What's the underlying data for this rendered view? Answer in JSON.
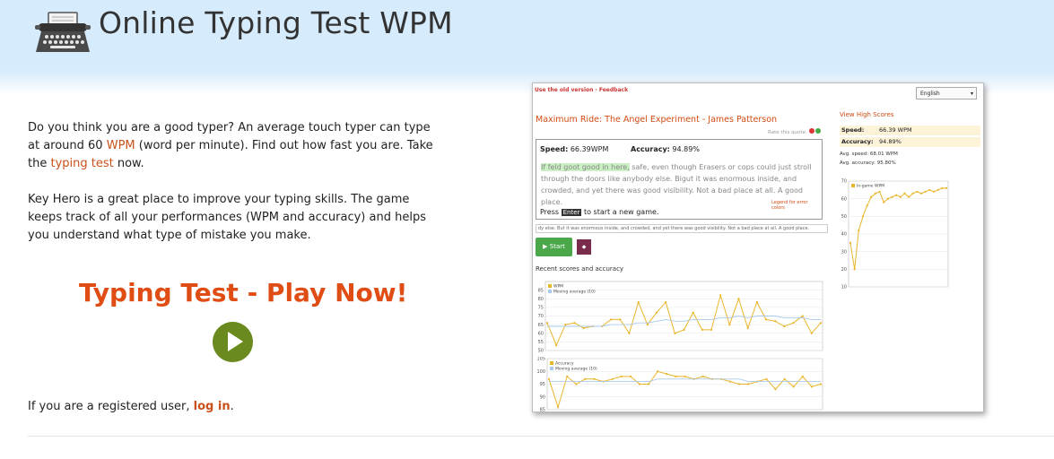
{
  "header": {
    "title": "Online Typing Test WPM",
    "logo_icon": "typewriter-icon",
    "bg": "#d6ebfb"
  },
  "intro": {
    "p1_a": "Do you think you are a good typer? An average touch typer can type at around 60 ",
    "p1_wpm": "WPM",
    "p1_b": " (word per minute). Find out how fast you are. Take the ",
    "p1_link": "typing test",
    "p1_c": " now.",
    "p2": "Key Hero is a great place to improve your typing skills. The game keeps track of all your performances (WPM and accuracy) and helps you understand what type of mistake you make."
  },
  "cta": {
    "label": "Typing Test - Play Now!",
    "play_icon": "play-icon",
    "accent": "#e04d14"
  },
  "login": {
    "text": "If you are a registered user, ",
    "link": "log in",
    "end": "."
  },
  "screenshot": {
    "old_version": "Use the old version · Feedback",
    "language": "English",
    "book_title": "Maximum Ride: The Angel Experiment - James Patterson",
    "rate_quote": "Rate this quote:",
    "speed_label": "Speed:",
    "speed_value": "66.39WPM",
    "accuracy_label": "Accuracy:",
    "accuracy_value": "94.89%",
    "passage_green": "If feld goot good in here,",
    "passage_rest": " safe, even though Erasers or cops could just stroll through the doors like anybody else. Bigut it was enormous inside, and crowded, and yet there was good visibility. Not a bad place at all. A good place.",
    "legend_link": "Legend for error colors",
    "press": "Press",
    "enter_key": "Enter",
    "press_rest": "to start a new game.",
    "strip_text": "dy else. But it was enormous inside, and crowded, and yet there was good visibility. Not a bad place at all. A good place.",
    "start_label": "Start",
    "recent_label": "Recent scores and accuracy",
    "view_high_scores": "View High Scores",
    "hs_speed_label": "Speed:",
    "hs_speed_value": "66.39 WPM",
    "hs_accuracy_label": "Accuracy:",
    "hs_accuracy_value": "94.89%",
    "avg_speed": "Avg. speed: 68.01 WPM",
    "avg_accuracy": "Avg. accuracy: 95.80%"
  },
  "chart_data": [
    {
      "type": "line",
      "series": [
        {
          "name": "WPM",
          "color": "#e8b52a",
          "values": [
            66,
            53,
            65,
            66,
            63,
            64,
            64,
            68,
            68,
            60,
            78,
            65,
            72,
            78,
            60,
            62,
            72,
            62,
            62,
            82,
            65,
            80,
            63,
            78,
            68,
            67,
            64,
            66,
            70,
            60,
            66
          ]
        },
        {
          "name": "Moving average (10)",
          "color": "#a9c9ef",
          "values": [
            64,
            64,
            64,
            64,
            64,
            64,
            64,
            65,
            65,
            65,
            66,
            66,
            67,
            68,
            67,
            67,
            68,
            68,
            68,
            69,
            69,
            70,
            69,
            70,
            70,
            70,
            69,
            69,
            69,
            68,
            68
          ]
        }
      ],
      "ylim": [
        50,
        90
      ],
      "yticks": [
        "85",
        "80",
        "75",
        "70",
        "65",
        "60",
        "55",
        "50"
      ]
    },
    {
      "type": "line",
      "series": [
        {
          "name": "Accuracy",
          "color": "#e8b52a",
          "values": [
            97,
            86,
            98,
            95,
            97,
            97,
            96,
            97,
            98,
            98,
            95,
            95,
            100,
            99,
            98,
            98,
            97,
            98,
            97,
            97,
            96,
            95,
            95,
            96,
            97,
            93,
            97,
            94,
            98,
            94,
            95
          ]
        },
        {
          "name": "Moving average (10)",
          "color": "#a9c9ef",
          "values": [
            96,
            96,
            96,
            96,
            96,
            96,
            96,
            96,
            96,
            96,
            96,
            96,
            97,
            97,
            97,
            97,
            97,
            97,
            97,
            97,
            97,
            97,
            96,
            96,
            96,
            96,
            96,
            96,
            96,
            96,
            96
          ]
        }
      ],
      "ylim": [
        85,
        105
      ],
      "yticks": [
        "105",
        "100",
        "95",
        "90",
        "85"
      ]
    },
    {
      "type": "line",
      "series": [
        {
          "name": "In-game WPM",
          "color": "#e8b52a",
          "values": [
            35,
            20,
            42,
            50,
            56,
            61,
            63,
            64,
            58,
            60,
            61,
            62,
            61,
            63,
            61,
            63,
            64,
            63,
            64,
            65,
            64,
            65,
            66,
            66
          ]
        }
      ],
      "ylim": [
        10,
        70
      ],
      "yticks": [
        "70",
        "60",
        "50",
        "40",
        "30",
        "20",
        "10"
      ]
    }
  ]
}
